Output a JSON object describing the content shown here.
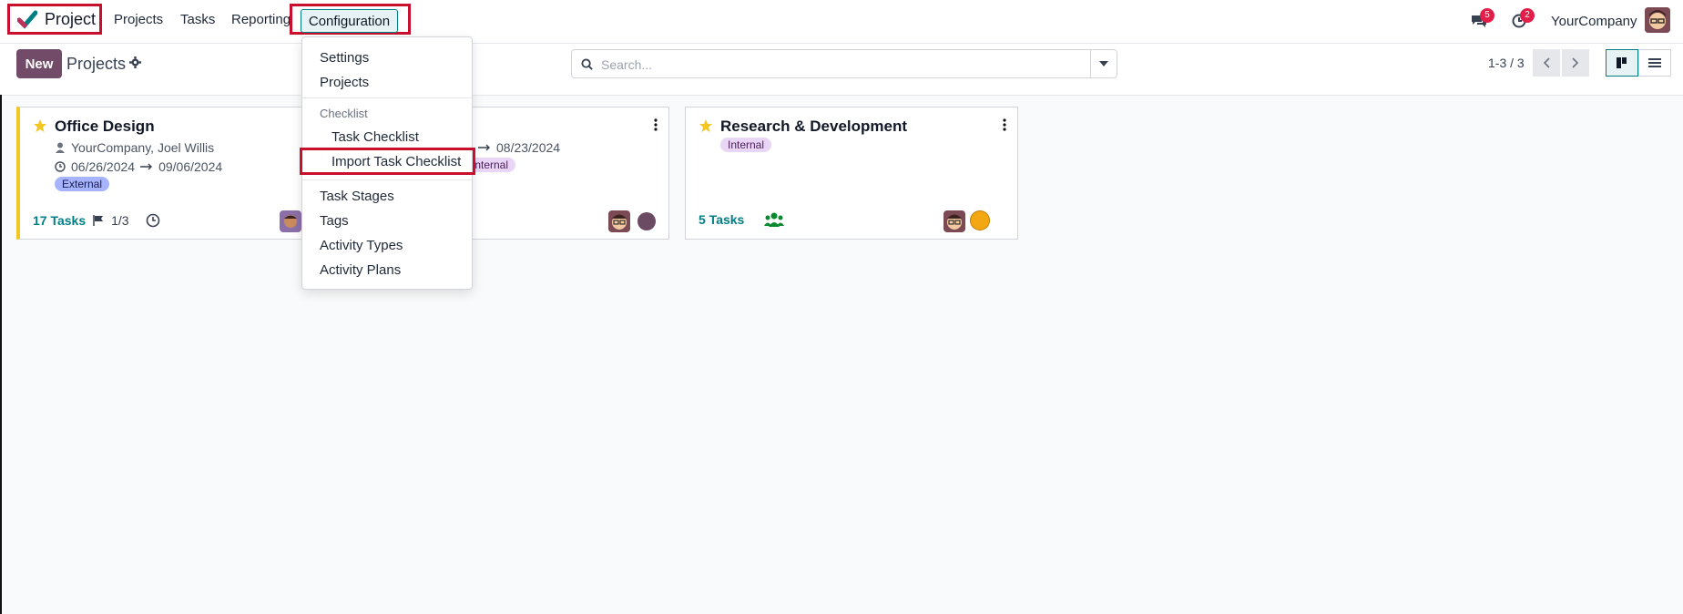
{
  "app": {
    "name": "Project",
    "company": "YourCompany"
  },
  "nav": {
    "items": [
      "Projects",
      "Tasks",
      "Reporting"
    ],
    "configuration": "Configuration"
  },
  "systray": {
    "messages_count": "5",
    "activities_count": "2"
  },
  "control": {
    "new_label": "New",
    "title": "Projects",
    "search_placeholder": "Search...",
    "pager": "1-3 / 3"
  },
  "dropdown": {
    "settings": "Settings",
    "projects": "Projects",
    "checklist_header": "Checklist",
    "task_checklist": "Task Checklist",
    "import_task_checklist": "Import Task Checklist",
    "task_stages": "Task Stages",
    "tags": "Tags",
    "activity_types": "Activity Types",
    "activity_plans": "Activity Plans"
  },
  "cards": [
    {
      "title": "Office Design",
      "customer": "YourCompany, Joel Willis",
      "start": "06/26/2024",
      "end": "09/06/2024",
      "tag": "External",
      "tasks": "17 Tasks",
      "milestones": "1/3"
    },
    {
      "end": "08/23/2024",
      "tag": "Internal"
    },
    {
      "title": "Research & Development",
      "tag": "Internal",
      "tasks": "5 Tasks"
    }
  ],
  "colors": {
    "brand": "#714b67",
    "accent": "#017e84",
    "highlight": "#c8102e"
  }
}
